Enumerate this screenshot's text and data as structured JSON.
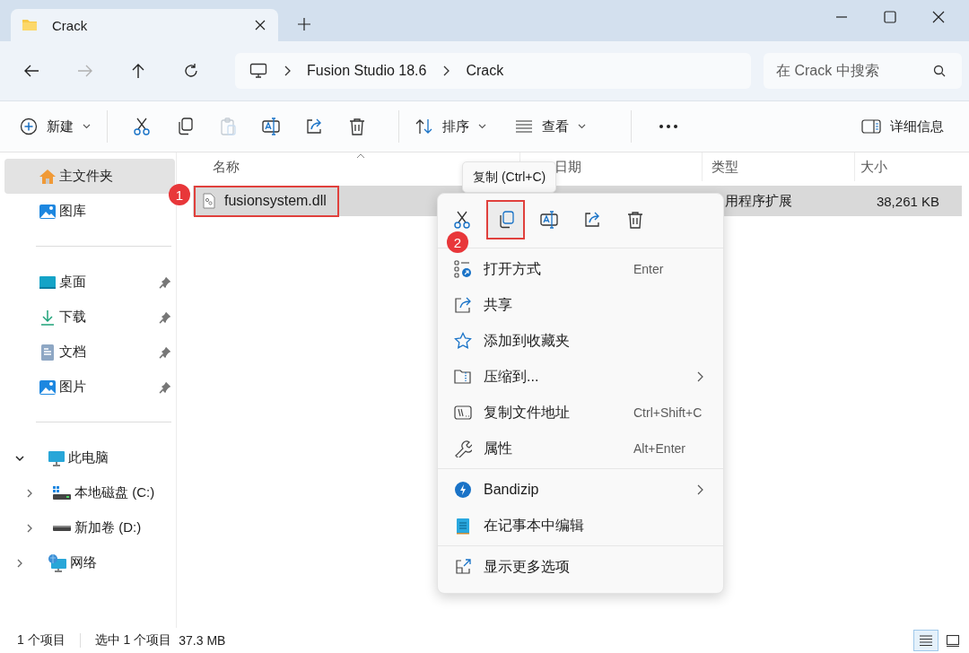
{
  "tab": {
    "title": "Crack"
  },
  "nav": {
    "back_disabled": false,
    "forward_disabled": true
  },
  "breadcrumb": [
    "Fusion Studio 18.6",
    "Crack"
  ],
  "search": {
    "placeholder": "在 Crack 中搜索"
  },
  "toolbar": {
    "new": "新建",
    "actions": [
      {
        "kind": "cut",
        "disabled": false
      },
      {
        "kind": "copy",
        "disabled": false
      },
      {
        "kind": "paste",
        "disabled": true
      },
      {
        "kind": "rename",
        "disabled": false
      },
      {
        "kind": "share",
        "disabled": false
      },
      {
        "kind": "delete",
        "disabled": false
      }
    ],
    "sort": "排序",
    "view": "查看",
    "details": "详细信息"
  },
  "sidebar": {
    "groups": [
      [
        {
          "kind": "home",
          "label": "主文件夹",
          "selected": true,
          "pinned": false
        },
        {
          "kind": "gallery",
          "label": "图库",
          "selected": false,
          "pinned": false
        }
      ],
      [
        {
          "kind": "desktop",
          "label": "桌面",
          "selected": false,
          "pinned": true
        },
        {
          "kind": "downloads",
          "label": "下载",
          "selected": false,
          "pinned": true
        },
        {
          "kind": "documents",
          "label": "文档",
          "selected": false,
          "pinned": true
        },
        {
          "kind": "pictures",
          "label": "图片",
          "selected": false,
          "pinned": true
        }
      ]
    ],
    "tree": [
      {
        "kind": "pc",
        "label": "此电脑",
        "expanded": true,
        "children": [
          {
            "kind": "drive-c",
            "label": "本地磁盘 (C:)",
            "expanded": false
          },
          {
            "kind": "drive",
            "label": "新加卷 (D:)",
            "expanded": false
          }
        ]
      },
      {
        "kind": "network",
        "label": "网络",
        "expanded": false
      }
    ]
  },
  "columns": [
    {
      "label": "名称",
      "sorted": true
    },
    {
      "label": "日期",
      "sorted": false
    },
    {
      "label": "类型",
      "sorted": false
    },
    {
      "label": "大小",
      "sorted": false
    }
  ],
  "files": [
    {
      "name": "fusionsystem.dll",
      "type": "用程序扩展",
      "size": "38,261 KB",
      "selected": true
    }
  ],
  "tooltip": "复制 (Ctrl+C)",
  "context_menu": {
    "groups": [
      [
        {
          "kind": "open-with",
          "label": "打开方式",
          "shortcut": "Enter",
          "submenu": false
        },
        {
          "kind": "share",
          "label": "共享",
          "submenu": false
        },
        {
          "kind": "star",
          "label": "添加到收藏夹",
          "submenu": false
        },
        {
          "kind": "zip",
          "label": "压缩到...",
          "submenu": true
        },
        {
          "kind": "copy-path",
          "label": "复制文件地址",
          "shortcut": "Ctrl+Shift+C",
          "submenu": false
        },
        {
          "kind": "wrench",
          "label": "属性",
          "shortcut": "Alt+Enter",
          "submenu": false
        }
      ],
      [
        {
          "kind": "bandizip",
          "label": "Bandizip",
          "submenu": true
        },
        {
          "kind": "notepad",
          "label": "在记事本中编辑",
          "submenu": false
        }
      ],
      [
        {
          "kind": "more",
          "label": "显示更多选项",
          "submenu": false
        }
      ]
    ]
  },
  "annotations": {
    "file_marker": "1",
    "copy_marker": "2"
  },
  "status_bar": {
    "count": "1 个项目",
    "selection": "选中 1 个项目",
    "size": "37.3 MB"
  },
  "view_buttons": [
    {
      "kind": "details",
      "selected": true
    },
    {
      "kind": "tiles",
      "selected": false
    }
  ]
}
